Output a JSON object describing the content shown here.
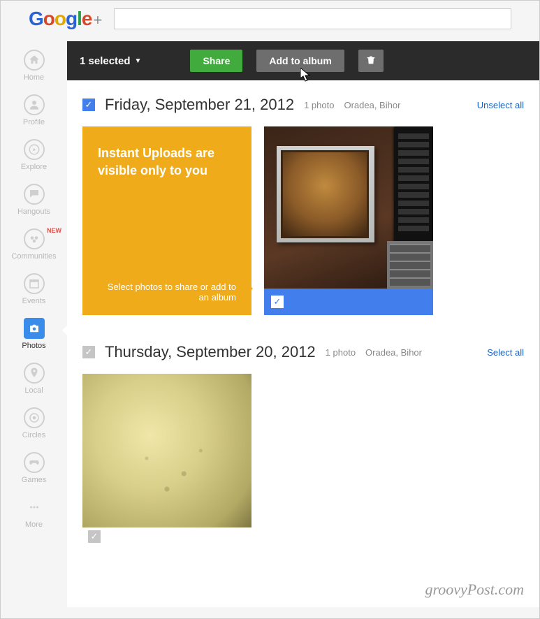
{
  "sidebar": {
    "items": [
      {
        "key": "home",
        "label": "Home"
      },
      {
        "key": "profile",
        "label": "Profile"
      },
      {
        "key": "explore",
        "label": "Explore"
      },
      {
        "key": "hangouts",
        "label": "Hangouts"
      },
      {
        "key": "communities",
        "label": "Communities",
        "badge": "NEW"
      },
      {
        "key": "events",
        "label": "Events"
      },
      {
        "key": "photos",
        "label": "Photos",
        "active": true
      },
      {
        "key": "local",
        "label": "Local"
      },
      {
        "key": "circles",
        "label": "Circles"
      },
      {
        "key": "games",
        "label": "Games"
      },
      {
        "key": "more",
        "label": "More"
      }
    ]
  },
  "actionbar": {
    "selected_label": "1 selected",
    "share": "Share",
    "add_to_album": "Add to album"
  },
  "groups": [
    {
      "checked": true,
      "date": "Friday, September 21, 2012",
      "count": "1 photo",
      "location": "Oradea, Bihor",
      "toggle": "Unselect all",
      "info": {
        "title": "Instant Uploads are visible only to you",
        "sub": "Select photos to share or add to an album"
      },
      "photo_selected": true
    },
    {
      "checked": false,
      "date": "Thursday, September 20, 2012",
      "count": "1 photo",
      "location": "Oradea, Bihor",
      "toggle": "Select all",
      "photo_selected": false
    }
  ],
  "watermark": "groovyPost.com"
}
